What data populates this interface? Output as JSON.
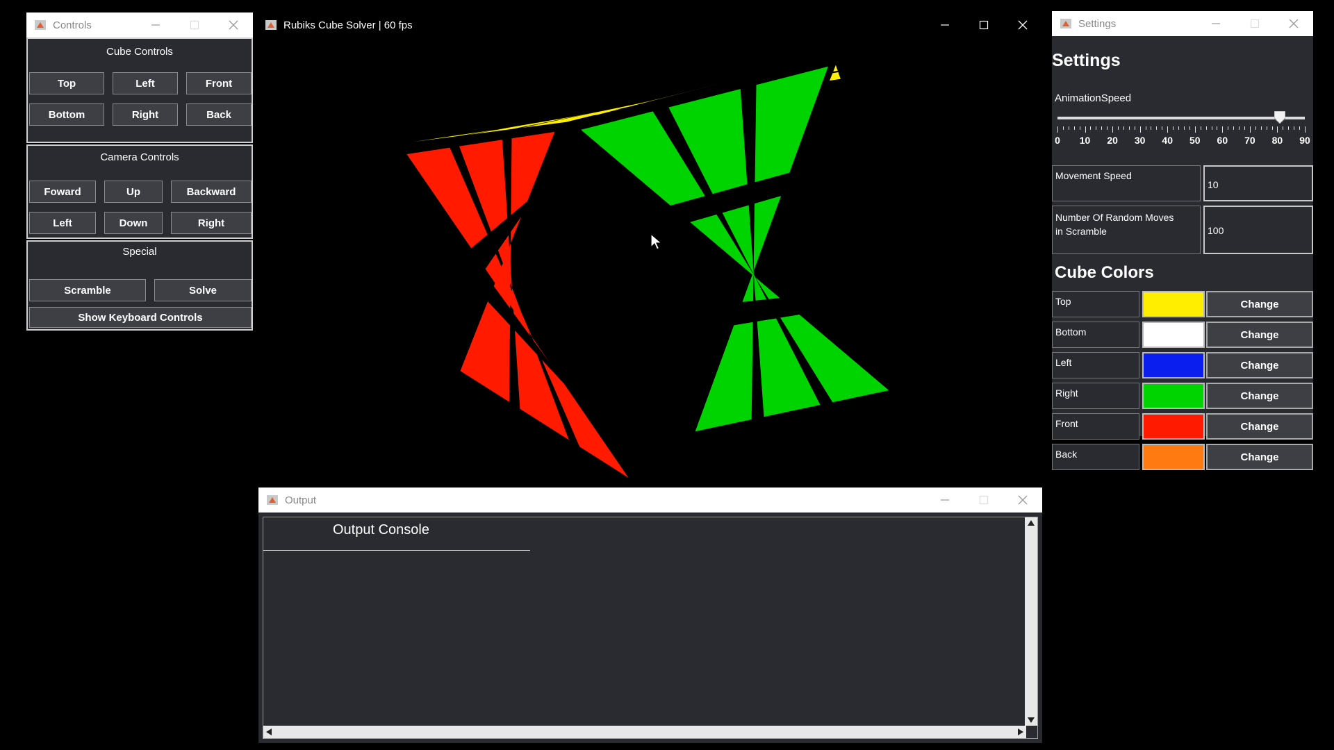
{
  "controls_window": {
    "title": "Controls",
    "cube_section_title": "Cube Controls",
    "cube_buttons": [
      "Top",
      "Left",
      "Front",
      "Bottom",
      "Right",
      "Back"
    ],
    "camera_section_title": "Camera Controls",
    "camera_buttons": [
      "Foward",
      "Up",
      "Backward",
      "Left",
      "Down",
      "Right"
    ],
    "special_section_title": "Special",
    "scramble_label": "Scramble",
    "solve_label": "Solve",
    "keyboard_controls_label": "Show Keyboard Controls"
  },
  "main_window": {
    "title": "Rubiks Cube Solver | 60 fps",
    "face_colors": {
      "top": "#ffee00",
      "front": "#ff1a00",
      "right": "#00d400"
    }
  },
  "settings_window": {
    "title": "Settings",
    "heading": "Settings",
    "animation_speed_label": "AnimationSpeed",
    "animation_speed_value": 81,
    "slider_min": 0,
    "slider_max": 90,
    "tick_labels": [
      "0",
      "10",
      "20",
      "30",
      "40",
      "50",
      "60",
      "70",
      "80",
      "90"
    ],
    "movement_speed_label": "Movement Speed",
    "movement_speed_value": "10",
    "random_moves_label_line1": "Number Of Random Moves",
    "random_moves_label_line2": "in Scramble",
    "random_moves_value": "100",
    "cube_colors_heading": "Cube Colors",
    "change_label": "Change",
    "colors": [
      {
        "face": "Top",
        "color": "#ffee00"
      },
      {
        "face": "Bottom",
        "color": "#ffffff"
      },
      {
        "face": "Left",
        "color": "#0a1ef0"
      },
      {
        "face": "Right",
        "color": "#00d400"
      },
      {
        "face": "Front",
        "color": "#ff1a00"
      },
      {
        "face": "Back",
        "color": "#ff7a10"
      }
    ]
  },
  "output_window": {
    "title": "Output",
    "console_title": "Output Console"
  }
}
